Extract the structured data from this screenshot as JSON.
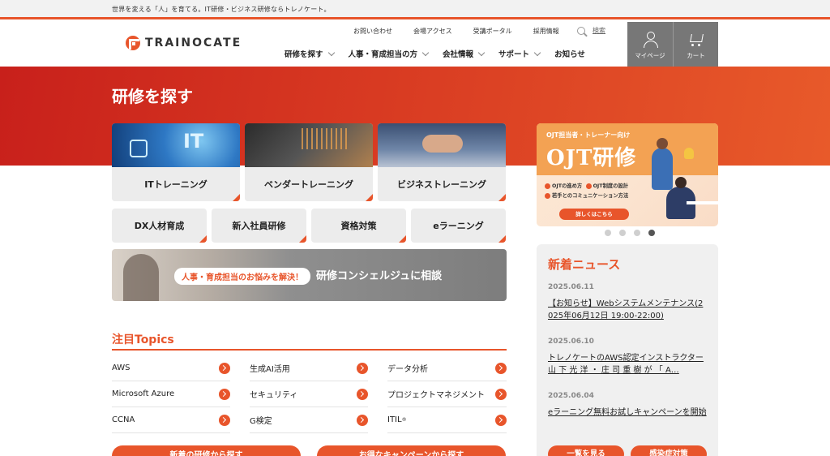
{
  "tagline": "世界を変える「人」を育てる。IT研修・ビジネス研修ならトレノケート。",
  "logo": {
    "text": "TRAINOCATE"
  },
  "util_links": [
    "お問い合わせ",
    "会場アクセス",
    "受講ポータル",
    "採用情報"
  ],
  "search": {
    "label": "検索"
  },
  "nav": [
    "研修を探す",
    "人事・育成担当の方",
    "会社情報",
    "サポート",
    "お知らせ"
  ],
  "header_buttons": {
    "mypage": "マイページ",
    "cart": "カート"
  },
  "page_title": "研修を探す",
  "training_cards": [
    {
      "label": "ITトレーニング",
      "photo_text": "IT"
    },
    {
      "label": "ベンダートレーニング"
    },
    {
      "label": "ビジネストレーニング"
    }
  ],
  "small_cards": [
    "DX人材育成",
    "新入社員研修",
    "資格対策",
    "eラーニング"
  ],
  "concierge": {
    "pill": "人事・育成担当のお悩みを解決！",
    "text": "研修コンシェルジュに相談"
  },
  "topics": {
    "title": "注目Topics",
    "items": [
      {
        "label": "AWS",
        "sup": ""
      },
      {
        "label": "生成AI活用",
        "sup": ""
      },
      {
        "label": "データ分析",
        "sup": ""
      },
      {
        "label": "Microsoft Azure",
        "sup": ""
      },
      {
        "label": "セキュリティ",
        "sup": ""
      },
      {
        "label": "プロジェクトマネジメント",
        "sup": ""
      },
      {
        "label": "CCNA",
        "sup": ""
      },
      {
        "label": "G検定",
        "sup": ""
      },
      {
        "label": "ITIL",
        "sup": "®"
      }
    ]
  },
  "cta_buttons": [
    "新着の研修から探す",
    "お得なキャンペーンから探す"
  ],
  "banner": {
    "subtitle": "OJT担当者・トレーナー向け",
    "title": "OJT研修",
    "points": [
      "OJTの進め方",
      "OJT制度の設計",
      "若手とのコミュニケーション方法"
    ],
    "button": "詳しくはこちら"
  },
  "carousel": {
    "count": 4,
    "active": 4
  },
  "news": {
    "title": "新着ニュース",
    "items": [
      {
        "date": "2025.06.11",
        "text": "【お知らせ】Webシステムメンテナンス(2025年06月12日 19:00-22:00)"
      },
      {
        "date": "2025.06.10",
        "text": "トレノケートのAWS認定インストラクター 山 下 光 洋 ・ 庄 司 重 樹 が 「 A…"
      },
      {
        "date": "2025.06.04",
        "text": "eラーニング無料お試しキャンペーンを開始"
      }
    ],
    "buttons": [
      "一覧を見る",
      "感染症対策"
    ]
  },
  "colors": {
    "accent": "#e8552b",
    "hero": "#d83a22",
    "header_button": "#777777"
  }
}
